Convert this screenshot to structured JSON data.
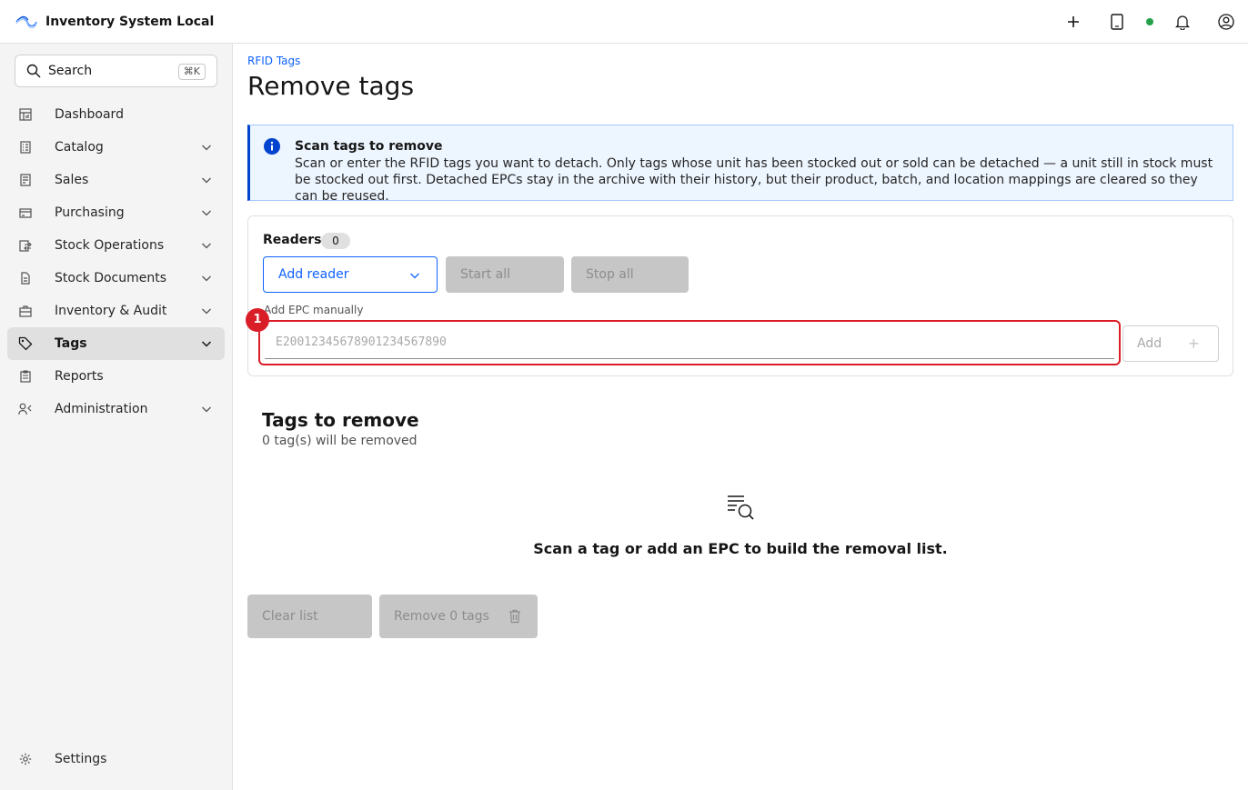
{
  "app": {
    "title": "Inventory System Local"
  },
  "header": {
    "icons": [
      "plus-icon",
      "tablet-icon",
      "status-online-dot",
      "notification-bell-icon",
      "user-avatar-icon"
    ]
  },
  "sidebar": {
    "search": {
      "label": "Search",
      "shortcut": "⌘K"
    },
    "items": [
      {
        "label": "Dashboard",
        "icon": "dashboard-icon",
        "expandable": false
      },
      {
        "label": "Catalog",
        "icon": "catalog-icon",
        "expandable": true
      },
      {
        "label": "Sales",
        "icon": "sales-icon",
        "expandable": true
      },
      {
        "label": "Purchasing",
        "icon": "purchasing-icon",
        "expandable": true
      },
      {
        "label": "Stock Operations",
        "icon": "stock-operations-icon",
        "expandable": true
      },
      {
        "label": "Stock Documents",
        "icon": "document-icon",
        "expandable": true
      },
      {
        "label": "Inventory & Audit",
        "icon": "briefcase-icon",
        "expandable": true
      },
      {
        "label": "Tags",
        "icon": "tag-icon",
        "expandable": true,
        "active": true
      },
      {
        "label": "Reports",
        "icon": "report-icon",
        "expandable": false
      },
      {
        "label": "Administration",
        "icon": "administration-icon",
        "expandable": true
      }
    ],
    "settings_label": "Settings"
  },
  "main": {
    "breadcrumb": "RFID Tags",
    "title": "Remove tags",
    "notice": {
      "title": "Scan tags to remove",
      "body": "Scan or enter the RFID tags you want to detach. Only tags whose unit has been stocked out or sold can be detached — a unit still in stock must be stocked out first. Detached EPCs stay in the archive with their history, but their product, batch, and location mappings are cleared so they can be reused."
    },
    "readers": {
      "title": "Readers",
      "count": "0",
      "add_reader_label": "Add reader",
      "start_all_label": "Start all",
      "stop_all_label": "Stop all"
    },
    "epc": {
      "label": "Add EPC manually",
      "placeholder": "E20012345678901234567890",
      "value": "",
      "add_label": "Add",
      "add_icon": "+",
      "marker": "1"
    },
    "tags_section": {
      "title": "Tags to remove",
      "subtitle": "0 tag(s) will be removed",
      "empty_text": "Scan a tag or add an EPC to build the removal list."
    },
    "actions": {
      "clear_label": "Clear list",
      "remove_label": "Remove 0 tags"
    }
  },
  "colors": {
    "accent": "#0f62fe",
    "danger": "#da1e28",
    "status_online": "#24a148",
    "info_bg": "#edf5ff"
  }
}
